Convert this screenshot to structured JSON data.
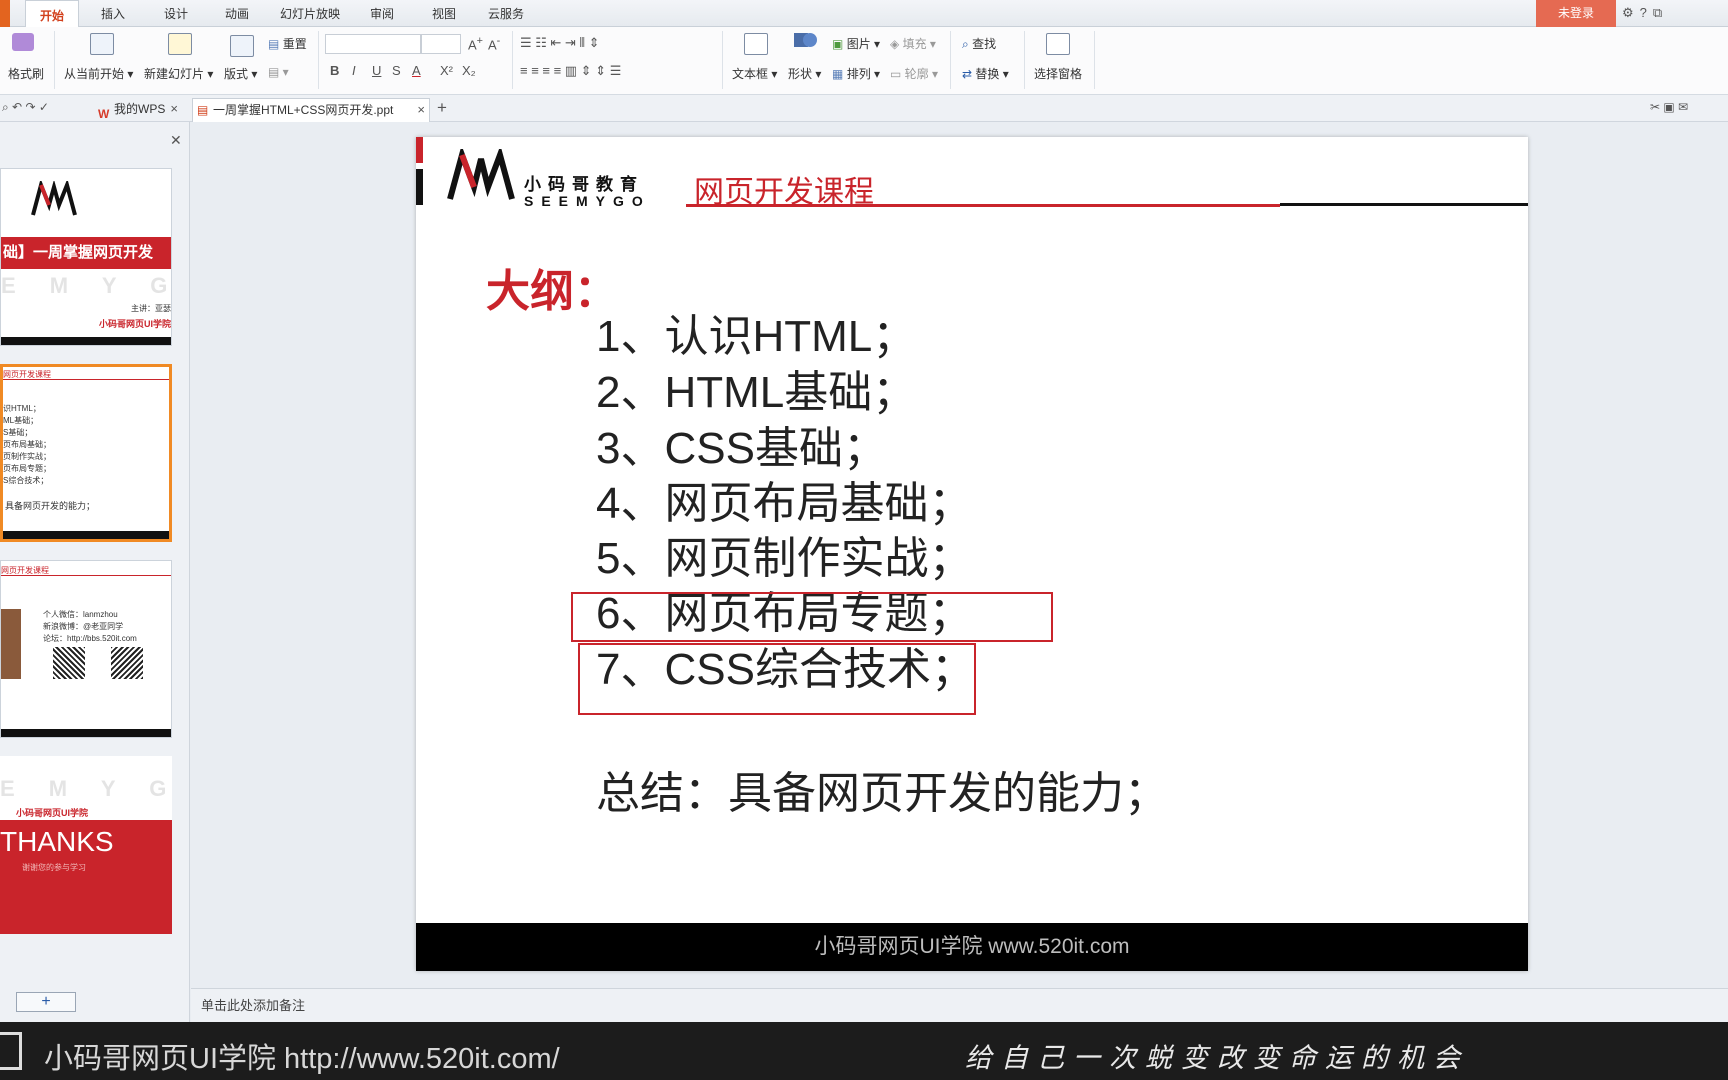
{
  "ribbon_tabs": [
    "开始",
    "插入",
    "设计",
    "动画",
    "幻灯片放映",
    "审阅",
    "视图",
    "云服务"
  ],
  "login_label": "未登录",
  "toolbar": {
    "format_painter": "格式刷",
    "from_current": "从当前开始",
    "new_slide": "新建幻灯片",
    "layout": "版式",
    "reset": "重置",
    "text_box": "文本框",
    "shape": "形状",
    "picture": "图片",
    "fill": "填充",
    "arrange": "排列",
    "outline": "轮廓",
    "find": "查找",
    "replace": "替换",
    "selection_pane": "选择窗格"
  },
  "doc_tabs": {
    "wps": "我的WPS",
    "file": "一周掌握HTML+CSS网页开发.ppt"
  },
  "thumbs": {
    "t1_title": "础】一周掌握网页开发",
    "t1_letters": "E M Y G O",
    "t1_lecturer": "主讲：亚瑟哥",
    "t1_brand": "小码哥网页UI学院",
    "t2_header": "网页开发课程",
    "t2_lines": [
      "识HTML；",
      "ML基础；",
      "S基础；",
      "页布局基础；",
      "页制作实战；",
      "页布局专题；",
      "S综合技术；"
    ],
    "t2_summary": "具备网页开发的能力；",
    "t3_header": "网页开发课程",
    "t3_lines": [
      "个人微信：lanmzhou",
      "新浪微博：@老亚同学",
      "论坛：http://bbs.520it.com"
    ],
    "t4_letters": "E M Y G O",
    "t4_brand": "小码哥网页UI学院",
    "t4_thanks": "THANKS",
    "t4_sub": "谢谢您的参与学习"
  },
  "slide": {
    "logo_cn": "小码哥教育",
    "logo_en": "SEEMYGO",
    "title": "网页开发课程",
    "outline_label": "大纲：",
    "items": [
      "1、认识HTML；",
      "2、HTML基础；",
      "3、CSS基础；",
      "4、网页布局基础；",
      "5、网页制作实战；",
      "6、网页布局专题；",
      "7、CSS综合技术；"
    ],
    "summary": "总结：具备网页开发的能力；",
    "footer": "小码哥网页UI学院  www.520it.com"
  },
  "notes_placeholder": "单击此处添加备注",
  "watermark": {
    "left": "小码哥网页UI学院  http://www.520it.com/",
    "slogan": "给自己一次蜕变改变命运的机会"
  },
  "colors": {
    "brand_red": "#c9242b",
    "tab_active": "#d2401c",
    "login_bg": "#e56a52",
    "thumb_selected": "#f08a24"
  }
}
